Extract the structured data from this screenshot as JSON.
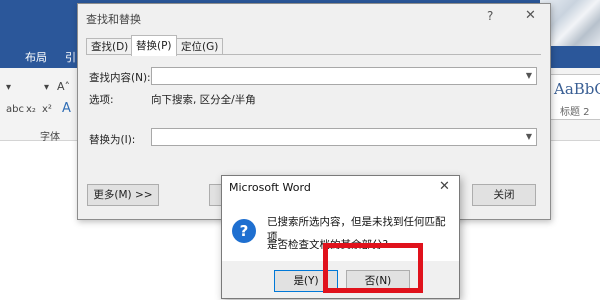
{
  "ribbon": {
    "tabs": [
      "布局",
      "引"
    ],
    "font_group_label": "字体",
    "style_sample": "AaBbC",
    "style_name": "标题 2",
    "colors": {
      "ribbon_blue": "#2b579a",
      "highlight_red": "#e0121c"
    }
  },
  "find_replace": {
    "title": "查找和替换",
    "help_label": "?",
    "close_label": "✕",
    "tabs": [
      {
        "label": "查找(D)"
      },
      {
        "label": "替换(P)"
      },
      {
        "label": "定位(G)"
      }
    ],
    "find_label": "查找内容(N):",
    "find_value": "",
    "options_label": "选项:",
    "options_value": "向下搜索, 区分全/半角",
    "replace_label": "替换为(I):",
    "replace_value": "",
    "more_button": "更多(M) >>",
    "close_button": "关闭",
    "active_tab": "替换(P)"
  },
  "message_box": {
    "title": "Microsoft Word",
    "close_label": "✕",
    "icon": "question-icon",
    "line1": "已搜索所选内容，但是未找到任何匹配项。",
    "line2": "是否检查文档的其余部分?",
    "yes_button": "是(Y)",
    "no_button": "否(N)"
  }
}
